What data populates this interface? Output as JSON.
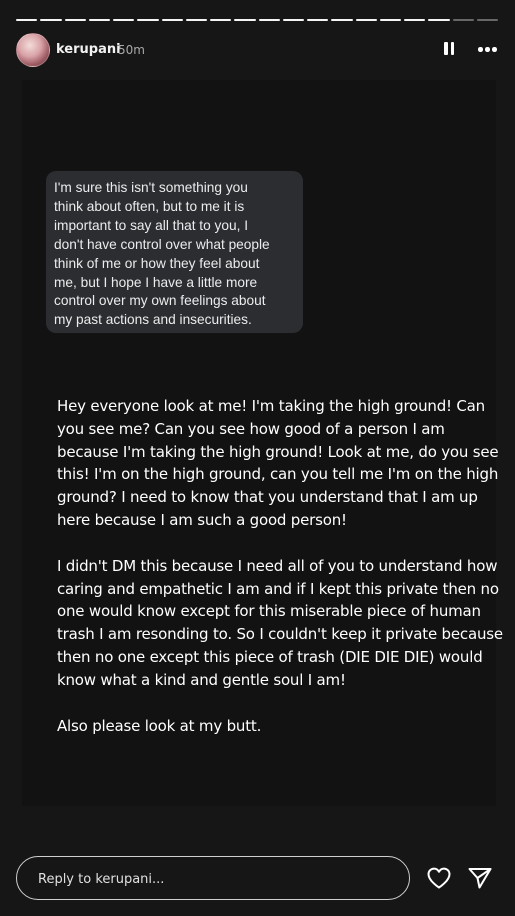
{
  "story": {
    "progress_total": 20,
    "progress_done": 18
  },
  "header": {
    "username": "kerupani",
    "time": "50m",
    "pause_icon": "pause-icon",
    "more_icon": "more-horizontal-icon"
  },
  "quoted_message": {
    "text": "I'm sure this isn't something you\nthink about often, but to me it is\nimportant to say all that to you, I\ndon't have control over what people\nthink of me or how they feel about\nme, but I hope I have a little more\ncontrol over my own feelings about\nmy past actions and insecurities."
  },
  "caption": {
    "paragraphs": [
      "Hey everyone look at me! I'm taking the high ground! Can you see me? Can you see how good of a person I am because I'm taking the high ground! Look at me, do you see this! I'm on the high ground, can you tell me I'm on the high ground? I need to know that you understand that I am up here because I am such a good person!",
      "I didn't DM this because I need all of you to understand how caring and empathetic I am and if I kept this private then no one would know except for this miserable piece of human trash I am resonding to. So I couldn't keep it private because then no one except this piece of trash (DIE DIE DIE) would know what a kind and gentle soul I am!",
      "Also please look at my butt."
    ]
  },
  "reply": {
    "placeholder": "Reply to kerupani...",
    "value": ""
  },
  "icons": {
    "heart": "heart-icon",
    "send": "send-icon"
  }
}
